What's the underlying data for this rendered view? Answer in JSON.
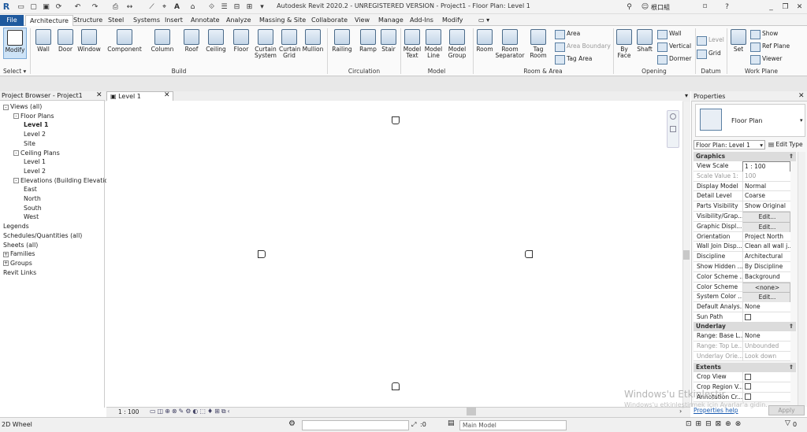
{
  "window": {
    "title": "Autodesk Revit 2020.2 - UNREGISTERED VERSION - Project1 - Floor Plan: Level 1",
    "user": "根口組"
  },
  "tabs": [
    "File",
    "Architecture",
    "Structure",
    "Steel",
    "Systems",
    "Insert",
    "Annotate",
    "Analyze",
    "Massing & Site",
    "Collaborate",
    "View",
    "Manage",
    "Add-Ins",
    "Modify"
  ],
  "ribbon": {
    "select": {
      "modify": "Modify",
      "select": "Select"
    },
    "build": [
      "Wall",
      "Door",
      "Window",
      "Component",
      "Column",
      "Roof",
      "Ceiling",
      "Floor",
      "Curtain System",
      "Curtain Grid",
      "Mullion"
    ],
    "build_group": "Build",
    "circulation": [
      "Railing",
      "Ramp",
      "Stair"
    ],
    "circulation_group": "Circulation",
    "model": [
      "Model Text",
      "Model Line",
      "Model Group"
    ],
    "model_group": "Model",
    "room": [
      "Room",
      "Room Separator",
      "Tag Room"
    ],
    "room_small": [
      "Area",
      "Area Boundary",
      "Tag Area"
    ],
    "room_group": "Room & Area",
    "opening": [
      "By Face",
      "Shaft"
    ],
    "opening_small": [
      "Wall",
      "Vertical",
      "Dormer"
    ],
    "opening_group": "Opening",
    "datum_small": [
      "Level",
      "Grid"
    ],
    "datum_group": "Datum",
    "workplane": [
      "Set"
    ],
    "workplane_small": [
      "Show",
      "Ref Plane",
      "Viewer"
    ],
    "workplane_group": "Work Plane"
  },
  "project_browser": {
    "title": "Project Browser - Project1",
    "items": [
      {
        "label": "Views (all)",
        "level": 0,
        "exp": "-"
      },
      {
        "label": "Floor Plans",
        "level": 1,
        "exp": "-"
      },
      {
        "label": "Level 1",
        "level": 2,
        "bold": true
      },
      {
        "label": "Level 2",
        "level": 2
      },
      {
        "label": "Site",
        "level": 2
      },
      {
        "label": "Ceiling Plans",
        "level": 1,
        "exp": "-"
      },
      {
        "label": "Level 1",
        "level": 2
      },
      {
        "label": "Level 2",
        "level": 2
      },
      {
        "label": "Elevations (Building Elevation)",
        "level": 1,
        "exp": "-"
      },
      {
        "label": "East",
        "level": 2
      },
      {
        "label": "North",
        "level": 2
      },
      {
        "label": "South",
        "level": 2
      },
      {
        "label": "West",
        "level": 2
      },
      {
        "label": "Legends",
        "level": 0
      },
      {
        "label": "Schedules/Quantities (all)",
        "level": 0
      },
      {
        "label": "Sheets (all)",
        "level": 0
      },
      {
        "label": "Families",
        "level": 0,
        "exp": "+"
      },
      {
        "label": "Groups",
        "level": 0,
        "exp": "+"
      },
      {
        "label": "Revit Links",
        "level": 0
      }
    ]
  },
  "view": {
    "tab": "Level 1",
    "scale": "1 : 100"
  },
  "properties": {
    "title": "Properties",
    "type": "Floor Plan",
    "selector": "Floor Plan: Level 1",
    "edit_type": "Edit Type",
    "sections": {
      "graphics": "Graphics",
      "underlay": "Underlay",
      "extents": "Extents"
    },
    "graphics": [
      {
        "k": "View Scale",
        "v": "1 : 100",
        "input": true
      },
      {
        "k": "Scale Value    1:",
        "v": "100",
        "dim": true
      },
      {
        "k": "Display Model",
        "v": "Normal"
      },
      {
        "k": "Detail Level",
        "v": "Coarse"
      },
      {
        "k": "Parts Visibility",
        "v": "Show Original"
      },
      {
        "k": "Visibility/Grap...",
        "v": "Edit...",
        "btn": true
      },
      {
        "k": "Graphic Displ...",
        "v": "Edit...",
        "btn": true
      },
      {
        "k": "Orientation",
        "v": "Project North"
      },
      {
        "k": "Wall Join Disp...",
        "v": "Clean all wall j..."
      },
      {
        "k": "Discipline",
        "v": "Architectural"
      },
      {
        "k": "Show Hidden ...",
        "v": "By Discipline"
      },
      {
        "k": "Color Scheme ...",
        "v": "Background"
      },
      {
        "k": "Color Scheme",
        "v": "<none>",
        "btn": true
      },
      {
        "k": "System Color ...",
        "v": "Edit...",
        "btn": true
      },
      {
        "k": "Default Analys...",
        "v": "None"
      },
      {
        "k": "Sun Path",
        "v": "",
        "check": true
      }
    ],
    "underlay": [
      {
        "k": "Range: Base L...",
        "v": "None"
      },
      {
        "k": "Range: Top Le...",
        "v": "Unbounded",
        "dim": true
      },
      {
        "k": "Underlay Orie...",
        "v": "Look down",
        "dim": true
      }
    ],
    "extents": [
      {
        "k": "Crop View",
        "v": "",
        "check": true
      },
      {
        "k": "Crop Region V...",
        "v": "",
        "check": true
      },
      {
        "k": "Annotation Cr...",
        "v": "",
        "check": true
      }
    ],
    "help": "Properties help",
    "apply": "Apply"
  },
  "status": {
    "left": "2D Wheel",
    "zero": ":0",
    "model": "Main Model",
    "right_zero": "0"
  },
  "watermark": {
    "line1": "Windows'u Etkinleştir",
    "line2": "Windows'u etkinleştirmek için Ayarlar'a gidin."
  }
}
